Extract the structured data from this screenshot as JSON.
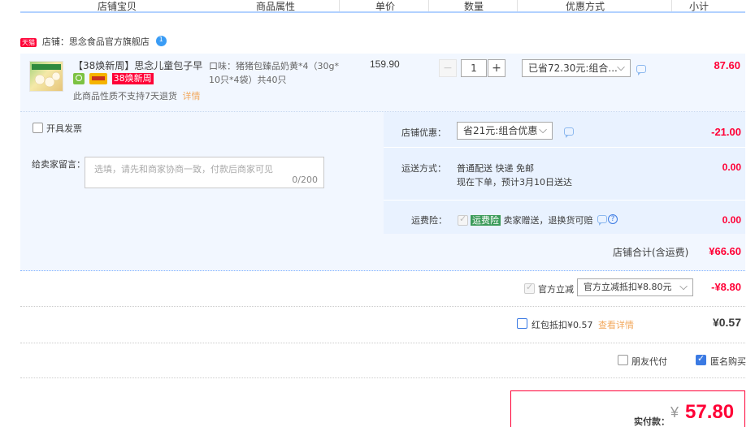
{
  "header": {
    "cols": [
      "店铺宝贝",
      "商品属性",
      "单价",
      "数量",
      "优惠方式",
      "小计"
    ]
  },
  "shop": {
    "badge": "天猫",
    "label": "店铺：",
    "name": "思念食品官方旗舰店",
    "wangwang_icon": "wangwang-chat-icon"
  },
  "item": {
    "title": "【38焕新周】思念儿童包子早...",
    "promo_tag": "38焕新周",
    "note": "此商品性质不支持7天退货",
    "note_link": "详情",
    "attr_line1": "口味：猪猪包臻品奶黄*4（30g*",
    "attr_line2": "10只*4袋）共40只",
    "price": "159.90",
    "qty": "1",
    "qty_minus": "−",
    "qty_plus": "+",
    "discount_select": "已省72.30元:组合...",
    "subtotal": "87.60"
  },
  "invoice": {
    "label": "开具发票"
  },
  "message": {
    "label": "给卖家留言：",
    "placeholder": "选填，请先和商家协商一致，付款后商家可见",
    "counter": "0/200"
  },
  "shop_discount": {
    "label": "店铺优惠：",
    "select": "省21元:组合优惠",
    "value": "-21.00"
  },
  "shipping": {
    "label": "运送方式：",
    "line1": "普通配送 快递 免邮",
    "line2": "现在下单，预计3月10日送达",
    "value": "0.00"
  },
  "insurance": {
    "label": "运费险：",
    "tag": "运费险",
    "text": "卖家赠送，退换货可赔",
    "value": "0.00"
  },
  "shop_total": {
    "label": "店铺合计(含运费)",
    "value": "¥66.60"
  },
  "official": {
    "label": "官方立减",
    "select": "官方立减抵扣¥8.80元",
    "value": "-¥8.80"
  },
  "redpacket": {
    "label": "红包抵扣¥0.57",
    "link": "查看详情",
    "value": "¥0.57"
  },
  "options": {
    "friend_pay": "朋友代付",
    "anonymous": "匿名购买"
  },
  "payment": {
    "label": "实付款：",
    "currency": "¥",
    "amount": "57.80"
  },
  "colors": {
    "accent_red": "#ff0036",
    "blue_bg": "#f2f7ff",
    "header_line": "#b2d1ff",
    "link_orange": "#f2a85d"
  }
}
